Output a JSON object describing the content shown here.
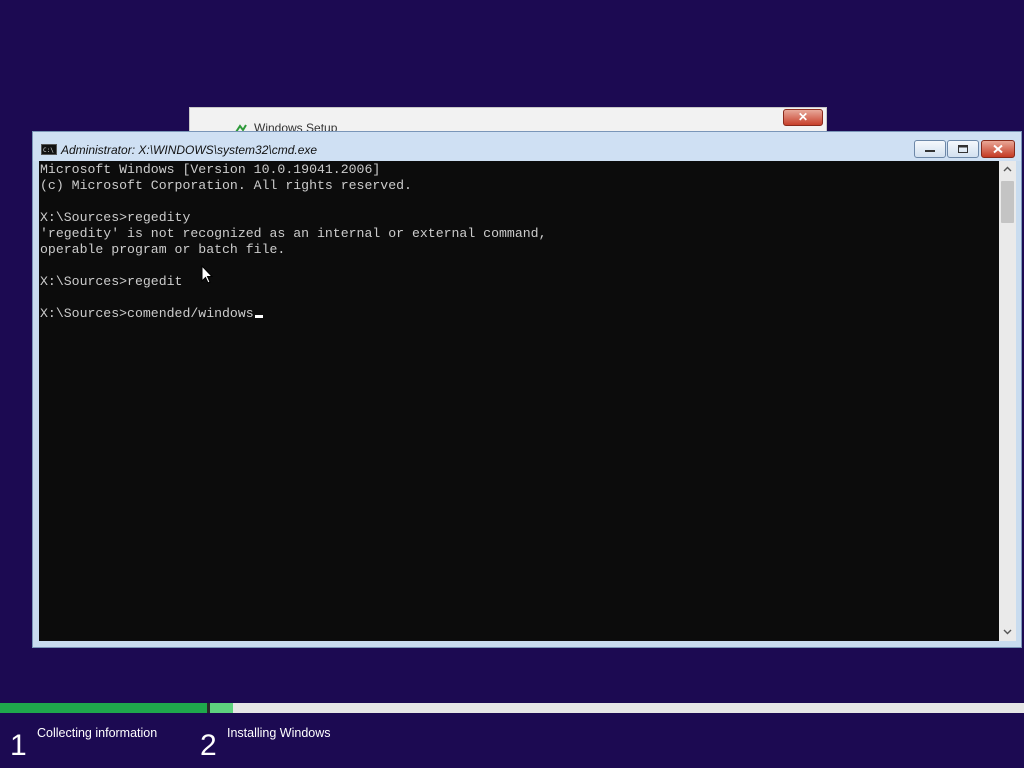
{
  "setup_window": {
    "title": "Windows Setup",
    "close_label": "✕"
  },
  "cmd_window": {
    "title": "Administrator: X:\\WINDOWS\\system32\\cmd.exe",
    "console_lines": [
      "Microsoft Windows [Version 10.0.19041.2006]",
      "(c) Microsoft Corporation. All rights reserved.",
      "",
      "X:\\Sources>regedity",
      "'regedity' is not recognized as an internal or external command,",
      "operable program or batch file.",
      "",
      "X:\\Sources>regedit",
      "",
      "X:\\Sources>comended/windows"
    ]
  },
  "progress": {
    "steps": [
      {
        "number": "1",
        "label": "Collecting information",
        "status": "complete"
      },
      {
        "number": "2",
        "label": "Installing Windows",
        "status": "in-progress"
      }
    ],
    "step2_fraction": 0.12
  },
  "colors": {
    "desktop_background": "#1c0a52",
    "console_background": "#0c0c0c",
    "console_text": "#cccccc",
    "progress_complete": "#1fa84c",
    "progress_current": "#5ed27e"
  },
  "icons": {
    "cmd": "cmd-icon",
    "setup": "setup-icon",
    "minimize": "minimize-icon",
    "maximize": "maximize-icon",
    "close": "close-icon",
    "cursor": "mouse-cursor-icon"
  }
}
